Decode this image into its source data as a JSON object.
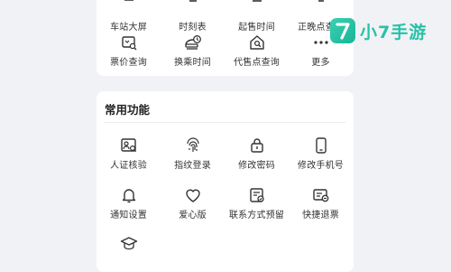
{
  "top_grid": {
    "row1": [
      {
        "label": "车站大屏",
        "icon": "screen-icon"
      },
      {
        "label": "时刻表",
        "icon": "timetable-icon"
      },
      {
        "label": "起售时间",
        "icon": "sale-time-icon"
      },
      {
        "label": "正晚点查询",
        "icon": "delay-query-icon"
      }
    ],
    "row2": [
      {
        "label": "票价查询",
        "icon": "fare-query-icon"
      },
      {
        "label": "换乘时间",
        "icon": "transfer-time-icon"
      },
      {
        "label": "代售点查询",
        "icon": "agency-query-icon"
      },
      {
        "label": "更多",
        "icon": "more-icon"
      }
    ]
  },
  "common": {
    "title": "常用功能",
    "items": [
      {
        "label": "人证核验",
        "icon": "id-verify-icon"
      },
      {
        "label": "指纹登录",
        "icon": "fingerprint-icon"
      },
      {
        "label": "修改密码",
        "icon": "lock-icon"
      },
      {
        "label": "修改手机号",
        "icon": "phone-icon"
      },
      {
        "label": "通知设置",
        "icon": "bell-icon"
      },
      {
        "label": "爱心版",
        "icon": "heart-icon"
      },
      {
        "label": "联系方式预留",
        "icon": "contact-reserve-icon"
      },
      {
        "label": "快捷退票",
        "icon": "quick-refund-icon"
      },
      {
        "label": "",
        "icon": "graduation-cap-icon"
      }
    ]
  },
  "watermark": {
    "text": "小7手游",
    "logo_glyph": "7",
    "color": "#26c2a6"
  }
}
